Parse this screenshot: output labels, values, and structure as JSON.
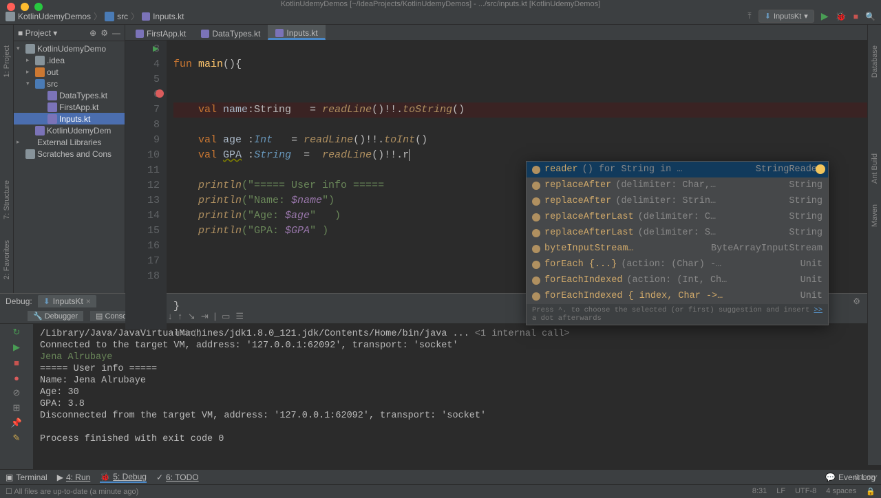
{
  "window": {
    "title": "KotlinUdemyDemos [~/IdeaProjects/KotlinUdemyDemos] - .../src/inputs.kt [KotlinUdemyDemos]"
  },
  "breadcrumb": {
    "root": "KotlinUdemyDemos",
    "dir": "src",
    "file": "Inputs.kt"
  },
  "run_config": {
    "name": "InputsKt"
  },
  "sidebar": {
    "title": "Project",
    "nodes": [
      {
        "label": "KotlinUdemyDemo",
        "icon": "dir",
        "arrow": "▾",
        "indent": 0
      },
      {
        "label": ".idea",
        "icon": "dir",
        "arrow": "▸",
        "indent": 1
      },
      {
        "label": "out",
        "icon": "dir-or",
        "arrow": "▸",
        "indent": 1
      },
      {
        "label": "src",
        "icon": "dir-blue",
        "arrow": "▾",
        "indent": 1
      },
      {
        "label": "DataTypes.kt",
        "icon": "kt",
        "arrow": "",
        "indent": 2
      },
      {
        "label": "FirstApp.kt",
        "icon": "kt",
        "arrow": "",
        "indent": 2
      },
      {
        "label": "Inputs.kt",
        "icon": "kt",
        "arrow": "",
        "indent": 2,
        "sel": true
      },
      {
        "label": "KotlinUdemyDem",
        "icon": "kt",
        "arrow": "",
        "indent": 1
      },
      {
        "label": "External Libraries",
        "icon": "lib",
        "arrow": "▸",
        "indent": 0
      },
      {
        "label": "Scratches and Cons",
        "icon": "dir",
        "arrow": "",
        "indent": 0
      }
    ]
  },
  "editor": {
    "tabs": [
      {
        "label": "FirstApp.kt",
        "active": false
      },
      {
        "label": "DataTypes.kt",
        "active": false
      },
      {
        "label": "Inputs.kt",
        "active": true
      }
    ],
    "context": "main()",
    "lines_start": 3,
    "lines_end": 18
  },
  "code": {
    "l3a": "fun ",
    "l3b": "main",
    "l3c": "(){",
    "l6": "    val name:String   = readLine()!!.toString()",
    "l6k": "val ",
    "l6n": "name",
    "l6t": ":String   = ",
    "l6c": "readLine",
    "l6r": "()!!.",
    "l6m": "toString",
    "l6e": "()",
    "l7k": "val ",
    "l7n": "age",
    "l7t": " :",
    "l7ty": "Int",
    "l7eq": "   = ",
    "l7c": "readLine",
    "l7r": "()!!.",
    "l7m": "toInt",
    "l7e": "()",
    "l8k": "val ",
    "l8n": "GPA",
    "l8t": " :",
    "l8ty": "String",
    "l8eq": "  =  ",
    "l8c": "readLine",
    "l8r": "()!!.r",
    "l10a": "println",
    "l10b": "(\"===== User info =====",
    "l11a": "println",
    "l11b": "(\"Name: ",
    "l11v": "$name",
    "l11c": "\")",
    "l12a": "println",
    "l12b": "(\"Age: ",
    "l12v": "$age",
    "l12c": "\"   )",
    "l13a": "println",
    "l13b": "(\"GPA: ",
    "l13v": "$GPA",
    "l13c": "\" )",
    "l18": "}"
  },
  "popup": {
    "items": [
      {
        "name": "reader",
        "sig": "()  for String in …",
        "ret": "StringReader",
        "match": "rea"
      },
      {
        "name": "replaceAfter",
        "sig": "(delimiter: Char,…",
        "ret": "String",
        "match": "r"
      },
      {
        "name": "replaceAfter",
        "sig": "(delimiter: Strin…",
        "ret": "String",
        "match": "r"
      },
      {
        "name": "replaceAfterLast",
        "sig": "(delimiter: C…",
        "ret": "String",
        "match": "r"
      },
      {
        "name": "replaceAfterLast",
        "sig": "(delimiter: S…",
        "ret": "String",
        "match": "r"
      },
      {
        "name": "byteInputStream…",
        "sig": "",
        "ret": "ByteArrayInputStream",
        "match": ""
      },
      {
        "name": "forEach {...}",
        "sig": " (action: (Char) -…",
        "ret": "Unit",
        "match": ""
      },
      {
        "name": "forEachIndexed",
        "sig": "(action: (Int, Ch…",
        "ret": "Unit",
        "match": ""
      },
      {
        "name": "forEachIndexed { index, Char ->…",
        "sig": "",
        "ret": "Unit",
        "match": ""
      }
    ],
    "hint": "Press ^. to choose the selected (or first) suggestion and insert a dot afterwards",
    "hint_link": ">>"
  },
  "debug": {
    "label": "Debug:",
    "config_tab": "InputsKt",
    "subtab1": "Debugger",
    "subtab2": "Console",
    "console_lines": [
      {
        "t": "/Library/Java/JavaVirtualMachines/jdk1.8.0_121.jdk/Contents/Home/bin/java ... ",
        "cls": ""
      },
      {
        "t": "<1 internal call>",
        "cls": "con-gray",
        "append": true
      },
      {
        "t": "Connected to the target VM, address: '127.0.0.1:62092', transport: 'socket'",
        "cls": ""
      },
      {
        "t": "Jena Alrubaye",
        "cls": "con-green"
      },
      {
        "t": "===== User info =====",
        "cls": ""
      },
      {
        "t": "Name: Jena Alrubaye",
        "cls": ""
      },
      {
        "t": "Age: 30",
        "cls": ""
      },
      {
        "t": "GPA: 3.8",
        "cls": ""
      },
      {
        "t": "Disconnected from the target VM, address: '127.0.0.1:62092', transport: 'socket'",
        "cls": ""
      },
      {
        "t": "",
        "cls": ""
      },
      {
        "t": "Process finished with exit code 0",
        "cls": ""
      }
    ]
  },
  "bottom": {
    "terminal": "Terminal",
    "run": "4: Run",
    "debug": "5: Debug",
    "todo": "6: TODO",
    "event_log": "Event Log"
  },
  "status": {
    "msg": "All files are up-to-date (a minute ago)",
    "pos": "8:31",
    "sep": "LF",
    "enc": "UTF-8",
    "indent": "4 spaces"
  },
  "vert_left": [
    "1: Project",
    "7: Structure",
    "2: Favorites"
  ],
  "vert_right": [
    "Database",
    "Ant Build",
    "Maven"
  ]
}
